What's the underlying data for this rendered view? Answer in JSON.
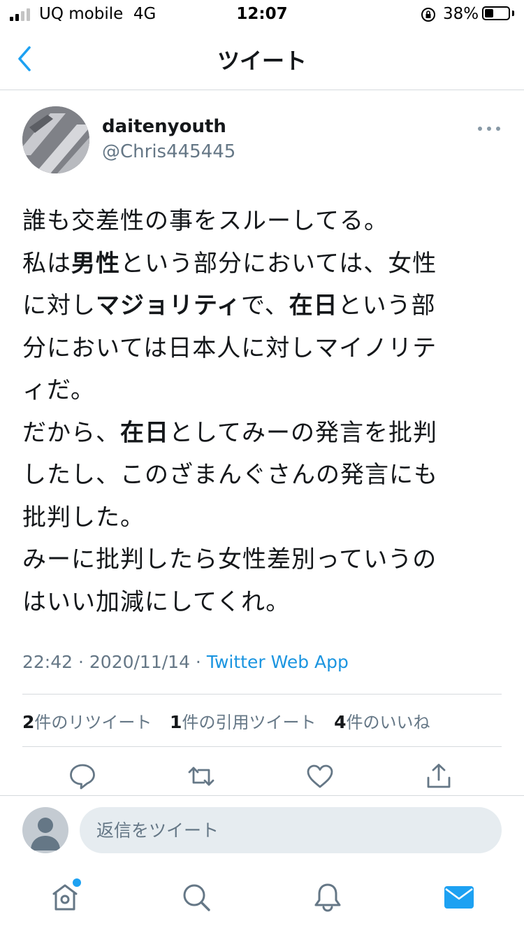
{
  "status_bar": {
    "carrier": "UQ mobile",
    "network": "4G",
    "time": "12:07",
    "battery": "38%",
    "battery_level": 0.38,
    "signal_bars": 2
  },
  "header": {
    "title": "ツイート"
  },
  "tweet": {
    "author_name": "daitenyouth",
    "author_handle": "@Chris445445",
    "text_lines": [
      [
        {
          "t": "誰も交差性の事をスルーしてる。",
          "b": false
        }
      ],
      [
        {
          "t": "私は",
          "b": false
        },
        {
          "t": "男性",
          "b": true
        },
        {
          "t": "という部分においては、女性",
          "b": false
        }
      ],
      [
        {
          "t": "に対し",
          "b": false
        },
        {
          "t": "マジョリティ",
          "b": true
        },
        {
          "t": "で、",
          "b": false
        },
        {
          "t": "在日",
          "b": true
        },
        {
          "t": "という部",
          "b": false
        }
      ],
      [
        {
          "t": "分においては日本人に対しマイノリテ",
          "b": false
        }
      ],
      [
        {
          "t": "ィだ。",
          "b": false
        }
      ],
      [
        {
          "t": "だから、",
          "b": false
        },
        {
          "t": "在日",
          "b": true
        },
        {
          "t": "としてみーの発言を批判",
          "b": false
        }
      ],
      [
        {
          "t": "したし、このざまんぐさんの発言にも",
          "b": false
        }
      ],
      [
        {
          "t": "批判した。",
          "b": false
        }
      ],
      [
        {
          "t": "みーに批判したら女性差別っていうの",
          "b": false
        }
      ],
      [
        {
          "t": "はいい加減にしてくれ。",
          "b": false
        }
      ]
    ],
    "time": "22:42",
    "date": "2020/11/14",
    "separator": " · ",
    "source": "Twitter Web App",
    "stats": [
      {
        "count": "2",
        "label": "件のリツイート"
      },
      {
        "count": "1",
        "label": "件の引用ツイート"
      },
      {
        "count": "4",
        "label": "件のいいね"
      }
    ]
  },
  "reply": {
    "placeholder": "返信をツイート"
  },
  "icons": {
    "back": "chevron-left-icon",
    "more": "ellipsis-icon",
    "reply": "comment-icon",
    "retweet": "retweet-icon",
    "like": "heart-icon",
    "share": "share-icon",
    "home": "home-icon",
    "search": "search-icon",
    "notifications": "bell-icon",
    "messages": "mail-icon"
  },
  "colors": {
    "accent": "#1da1f2",
    "link": "#1b95e0",
    "secondary_text": "#657786",
    "icon_gray": "#657786"
  }
}
